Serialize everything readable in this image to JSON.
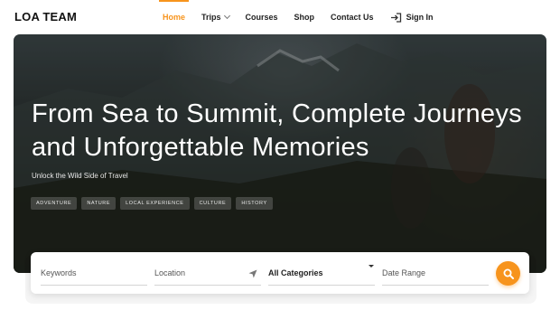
{
  "brand": {
    "logo_text": "LOA TEAM",
    "accent_color": "#f7941d"
  },
  "nav": {
    "items": [
      {
        "label": "Home",
        "active": true
      },
      {
        "label": "Trips",
        "has_dropdown": true
      },
      {
        "label": "Courses"
      },
      {
        "label": "Shop"
      },
      {
        "label": "Contact Us"
      }
    ],
    "signin_label": "Sign In",
    "signin_icon": "sign-in-icon"
  },
  "hero": {
    "title": "From Sea to Summit, Complete Journeys and Unforgettable Memories",
    "subtitle": "Unlock the Wild Side of Travel",
    "tags": [
      "ADVENTURE",
      "NATURE",
      "LOCAL EXPERIENCE",
      "CULTURE",
      "HISTORY"
    ]
  },
  "search": {
    "keywords_placeholder": "Keywords",
    "location_placeholder": "Location",
    "location_icon": "location-arrow-icon",
    "category_value": "All Categories",
    "date_placeholder": "Date Range",
    "search_icon": "search-icon"
  }
}
